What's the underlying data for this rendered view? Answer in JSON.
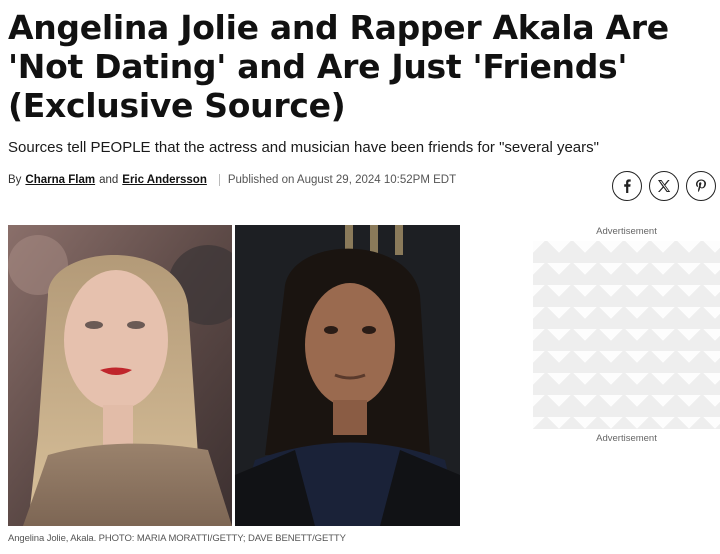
{
  "article": {
    "headline": "Angelina Jolie and Rapper Akala Are 'Not Dating' and Are Just 'Friends' (Exclusive Source)",
    "dek": "Sources tell PEOPLE that the actress and musician have been friends for \"several years\"",
    "byline": {
      "by_label": "By",
      "author1": "Charna Flam",
      "and_label": "and",
      "author2": "Eric Andersson",
      "published": "Published on August 29, 2024 10:52PM EDT"
    },
    "share": [
      "facebook-icon",
      "x-twitter-icon",
      "pinterest-icon"
    ],
    "caption": "Angelina Jolie, Akala. PHOTO: MARIA MORATTI/GETTY; DAVE BENETT/GETTY"
  },
  "sidebar": {
    "ad_label_top": "Advertisement",
    "ad_label_bottom": "Advertisement"
  },
  "colors": {
    "text": "#111111",
    "muted": "#555555",
    "ad_placeholder": "#eeeeee"
  }
}
